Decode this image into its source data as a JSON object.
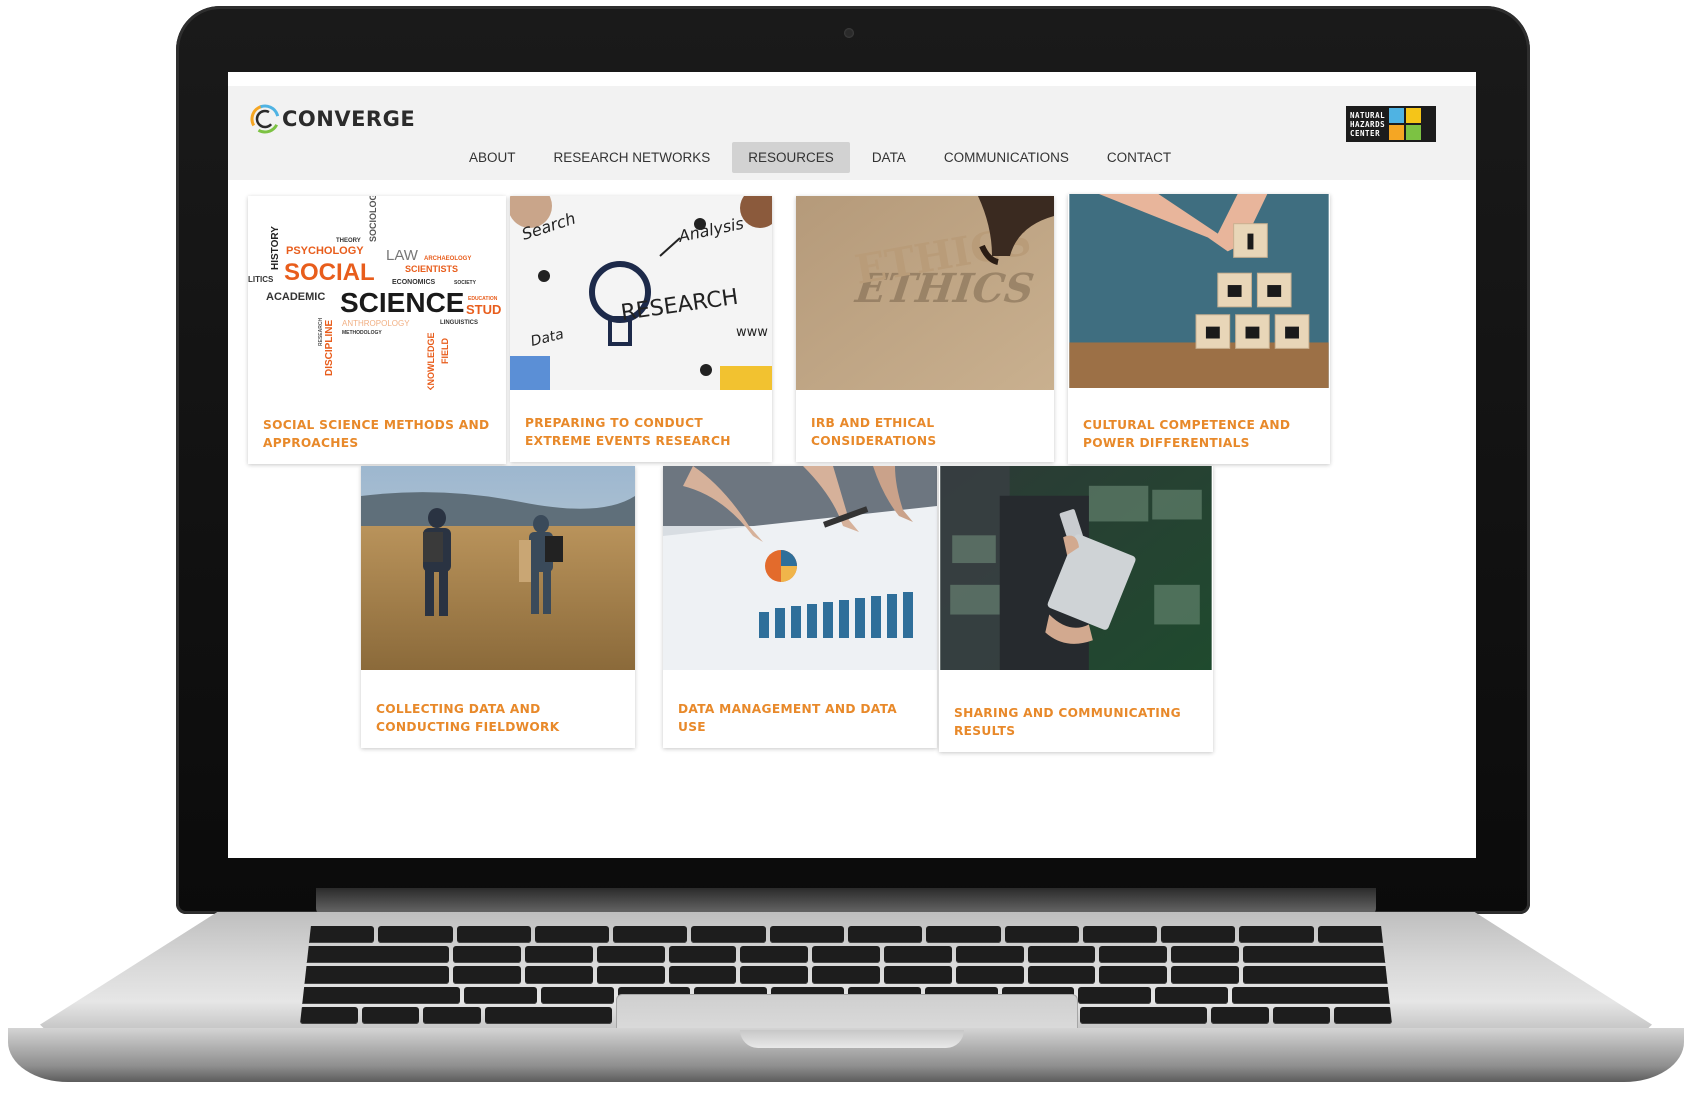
{
  "site": {
    "logo_text": "CONVERGE",
    "partner_logo_text": "NATURAL\nHAZARDS\nCENTER"
  },
  "nav": {
    "items": [
      {
        "label": "ABOUT",
        "active": false
      },
      {
        "label": "RESEARCH NETWORKS",
        "active": false
      },
      {
        "label": "RESOURCES",
        "active": true
      },
      {
        "label": "DATA",
        "active": false
      },
      {
        "label": "COMMUNICATIONS",
        "active": false
      },
      {
        "label": "CONTACT",
        "active": false
      }
    ]
  },
  "cards": [
    {
      "title": "SOCIAL SCIENCE METHODS AND APPROACHES",
      "image": "social-science-word-cloud"
    },
    {
      "title": "PREPARING TO CONDUCT EXTREME EVENTS RESEARCH",
      "image": "research-whiteboard"
    },
    {
      "title": "IRB AND ETHICAL CONSIDERATIONS",
      "image": "ethics-letters"
    },
    {
      "title": "CULTURAL COMPETENCE AND POWER DIFFERENTIALS",
      "image": "people-blocks"
    },
    {
      "title": "COLLECTING DATA AND CONDUCTING FIELDWORK",
      "image": "hikers-field"
    },
    {
      "title": "DATA MANAGEMENT AND DATA USE",
      "image": "charts-on-table"
    },
    {
      "title": "SHARING AND COMMUNICATING RESULTS",
      "image": "tablet-phone-collage"
    }
  ],
  "wordcloud": {
    "words": [
      "SOCIAL",
      "SCIENCE",
      "HISTORY",
      "PSYCHOLOGY",
      "THEORY",
      "SOCIOLOGY",
      "LAW",
      "ARCHAEOLOGY",
      "SCIENTISTS",
      "ECONOMICS",
      "SOCIETY",
      "ACADEMIC",
      "EDUCATION",
      "STUD",
      "LITICS",
      "ANTHROPOLOGY",
      "LINGUISTICS",
      "METHODOLOGY",
      "DISCIPLINE",
      "RESEARCH",
      "KNOWLEDGE",
      "FIELD"
    ]
  },
  "whiteboard": {
    "words": [
      "Search",
      "Analysis",
      "RESEARCH",
      "Data",
      "www"
    ]
  },
  "ethics": {
    "word": "ETHICS"
  },
  "colors": {
    "accent": "#e8892a",
    "nav_active_bg": "#d2d2d2",
    "header_bg": "#f2f2f2"
  }
}
